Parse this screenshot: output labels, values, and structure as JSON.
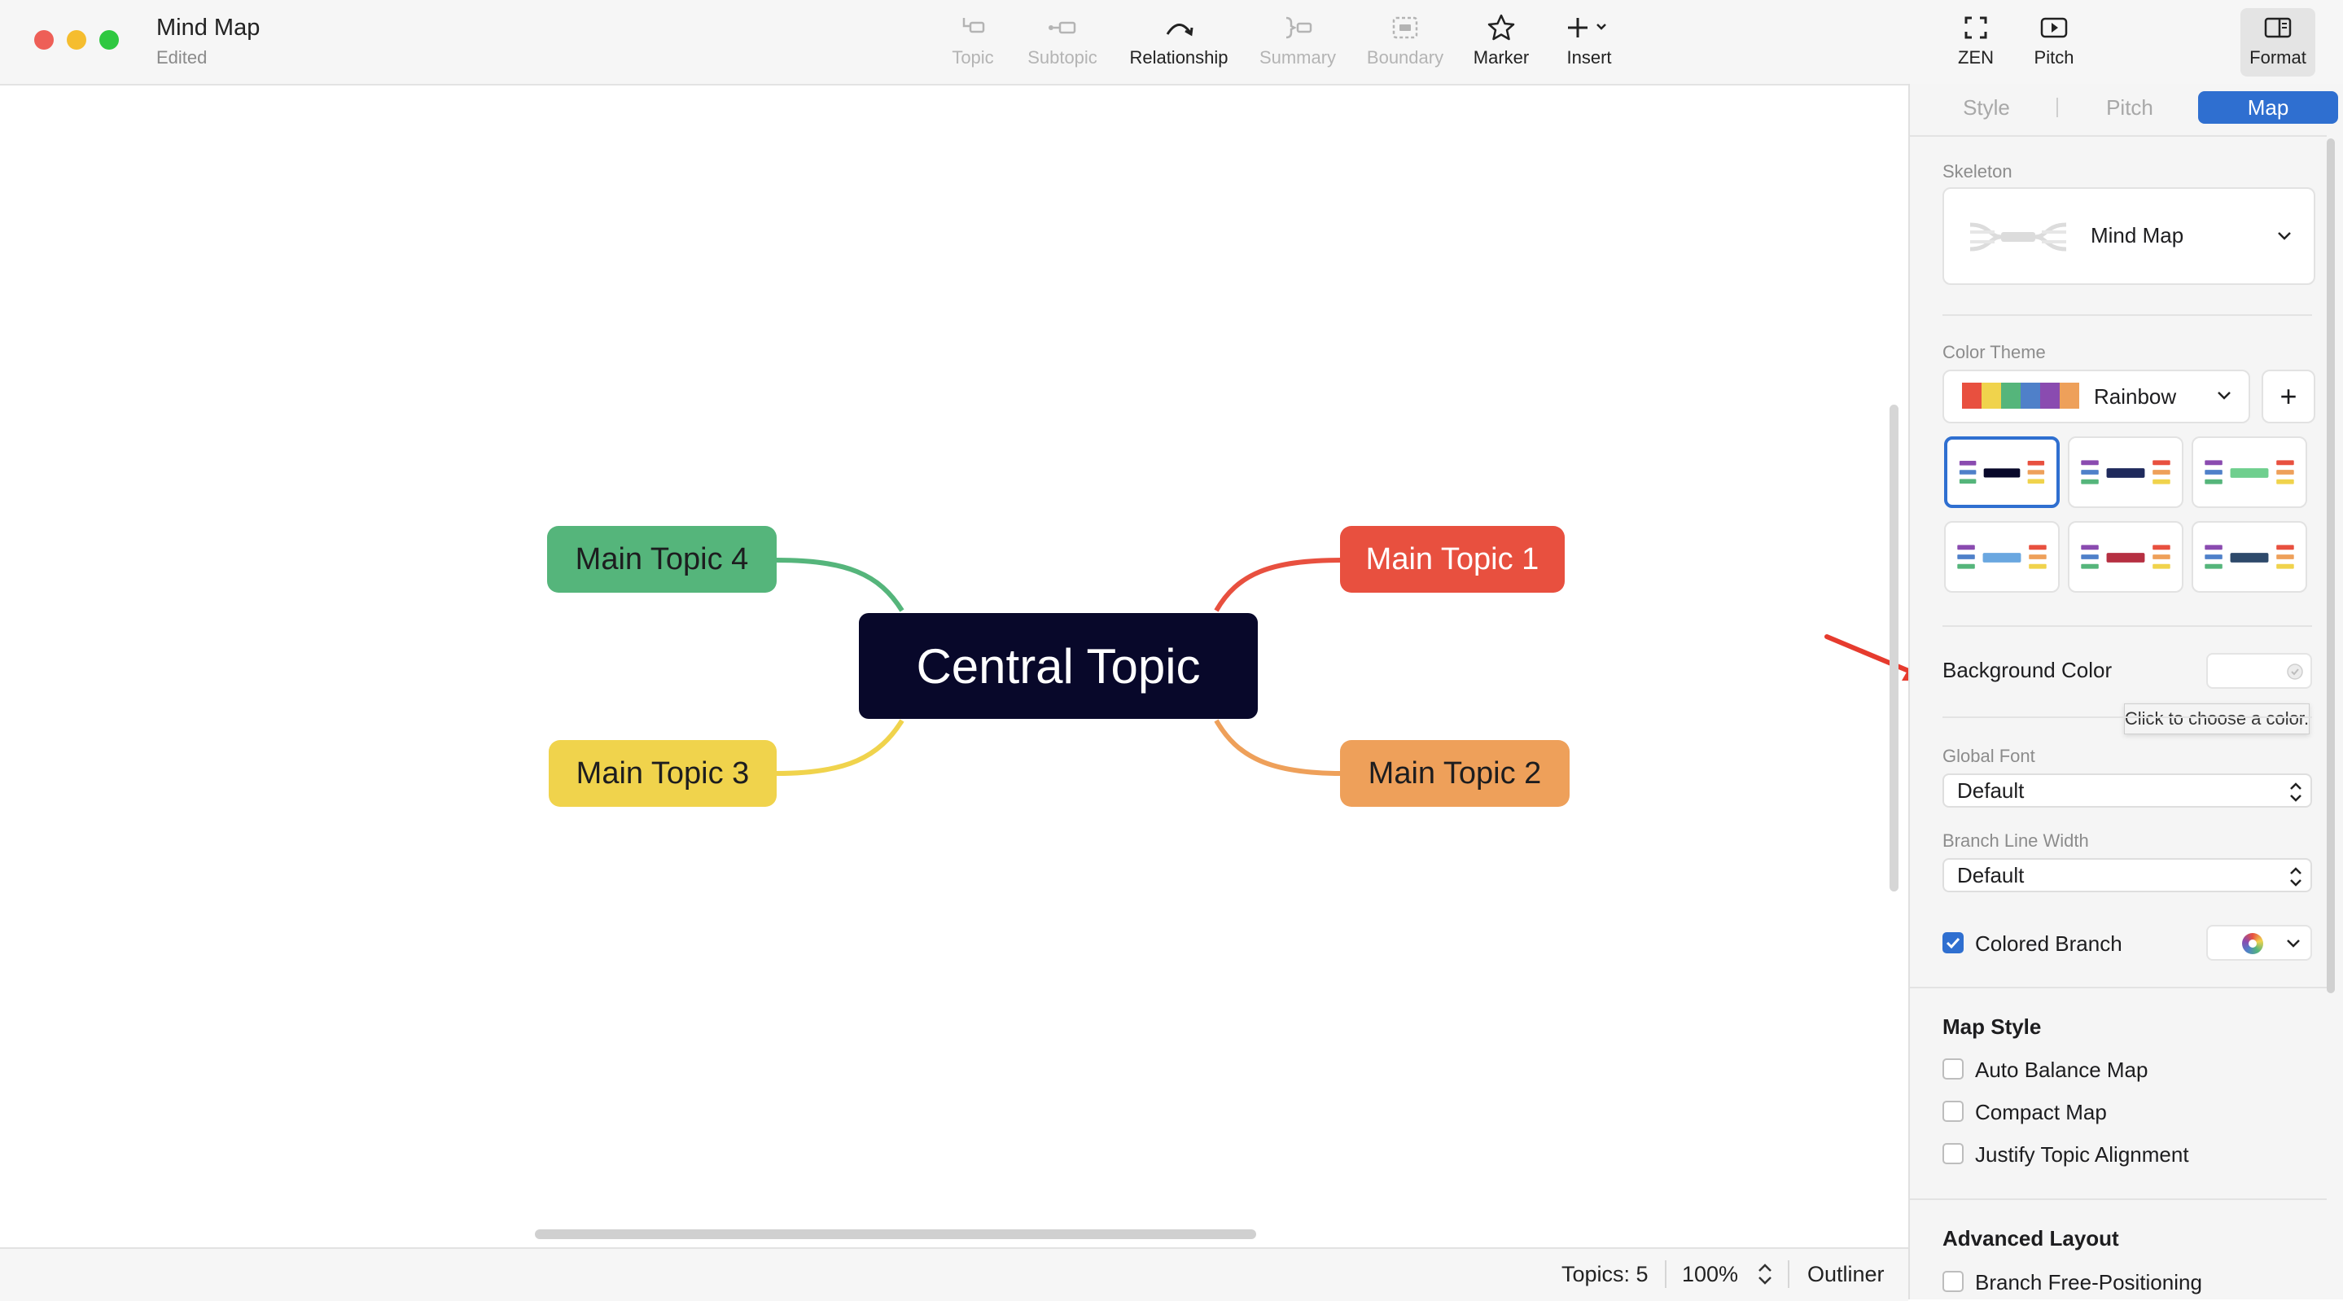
{
  "window": {
    "title": "Mind Map",
    "subtitle": "Edited"
  },
  "toolbar": {
    "items": [
      {
        "label": "Topic",
        "icon": "topic-icon",
        "enabled": false
      },
      {
        "label": "Subtopic",
        "icon": "subtopic-icon",
        "enabled": false
      },
      {
        "label": "Relationship",
        "icon": "relationship-icon",
        "enabled": true
      },
      {
        "label": "Summary",
        "icon": "summary-icon",
        "enabled": false
      },
      {
        "label": "Boundary",
        "icon": "boundary-icon",
        "enabled": false
      },
      {
        "label": "Marker",
        "icon": "star-icon",
        "enabled": true
      },
      {
        "label": "Insert",
        "icon": "plus-icon",
        "enabled": true
      }
    ],
    "right_items": [
      {
        "label": "ZEN",
        "icon": "fullscreen-icon"
      },
      {
        "label": "Pitch",
        "icon": "play-icon"
      },
      {
        "label": "Format",
        "icon": "sidebar-icon",
        "active": true
      }
    ]
  },
  "mindmap": {
    "central": {
      "label": "Central Topic",
      "color": "#08082a",
      "text_color": "#ffffff"
    },
    "topics": [
      {
        "label": "Main Topic 1",
        "color": "#e8503f",
        "text_color": "#ffffff"
      },
      {
        "label": "Main Topic 2",
        "color": "#eea05a",
        "text_color": "#1d1d1f"
      },
      {
        "label": "Main Topic 3",
        "color": "#f0d34c",
        "text_color": "#1d1d1f"
      },
      {
        "label": "Main Topic 4",
        "color": "#55b57b",
        "text_color": "#1d1d1f"
      }
    ]
  },
  "statusbar": {
    "topics": "Topics: 5",
    "zoom": "100%",
    "outliner": "Outliner"
  },
  "panel": {
    "tabs": [
      {
        "label": "Style",
        "active": false
      },
      {
        "label": "Pitch",
        "active": false
      },
      {
        "label": "Map",
        "active": true
      }
    ],
    "skeleton": {
      "label": "Skeleton",
      "value": "Mind Map"
    },
    "color_theme": {
      "label": "Color Theme",
      "value": "Rainbow",
      "add_label": "+",
      "swatches": [
        "#e8503f",
        "#f0d34c",
        "#55b57b",
        "#4f80c9",
        "#8a4bb0",
        "#eea05a"
      ]
    },
    "themes": [
      {
        "center": "#08082a",
        "selected": true
      },
      {
        "center": "#1f2a5c",
        "selected": false
      },
      {
        "center": "#6fcf8e",
        "selected": false
      },
      {
        "center": "#6aa7e0",
        "selected": false
      },
      {
        "center": "#b63042",
        "selected": false
      },
      {
        "center": "#2e4a6b",
        "selected": false
      }
    ],
    "background_color": {
      "label": "Background Color",
      "tooltip": "Click to choose a color."
    },
    "global_font": {
      "label": "Global Font",
      "value": "Default"
    },
    "branch_line_width": {
      "label": "Branch Line Width",
      "value": "Default"
    },
    "colored_branch": {
      "label": "Colored Branch",
      "checked": true
    },
    "map_style": {
      "title": "Map Style",
      "options": [
        {
          "label": "Auto Balance Map",
          "checked": false
        },
        {
          "label": "Compact Map",
          "checked": false
        },
        {
          "label": "Justify Topic Alignment",
          "checked": false
        }
      ]
    },
    "advanced_layout": {
      "title": "Advanced Layout",
      "options": [
        {
          "label": "Branch Free-Positioning",
          "checked": false
        }
      ]
    }
  },
  "colors": {
    "accent": "#2f6fd0",
    "annotation_arrow": "#e63b2e"
  }
}
